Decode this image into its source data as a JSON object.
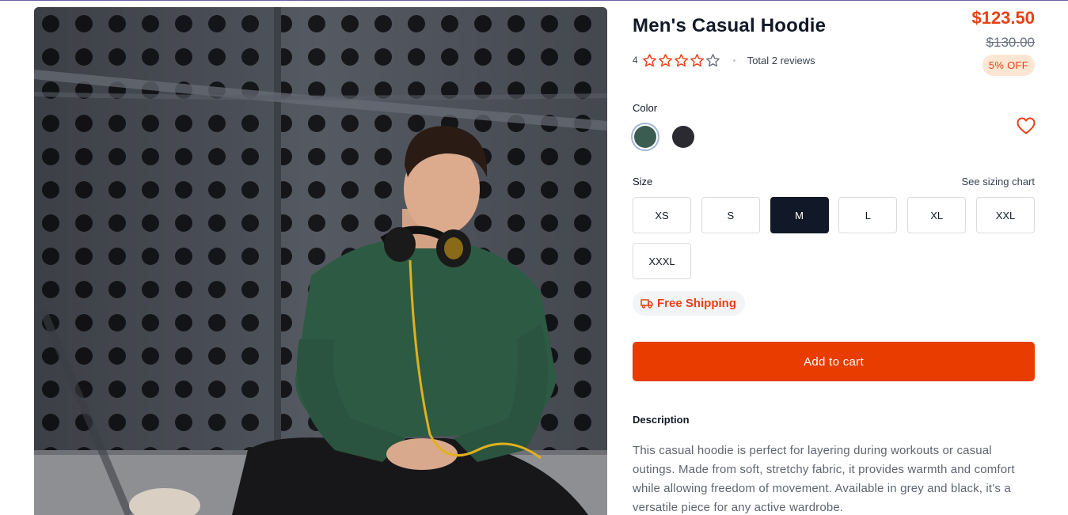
{
  "product": {
    "title": "Men's Casual Hoodie",
    "image_alt": "man in green hoodie with headphones",
    "price": "$123.50",
    "old_price": "$130.00",
    "discount": "5% OFF",
    "rating_value": "4",
    "rating_stars_filled": 4,
    "rating_stars_total": 5,
    "reviews": "Total 2 reviews"
  },
  "colors": {
    "label": "Color",
    "options": [
      {
        "name": "green",
        "hex": "#3b5c50",
        "selected": true
      },
      {
        "name": "black",
        "hex": "#2a2a30",
        "selected": false
      }
    ]
  },
  "sizes": {
    "label": "Size",
    "chart_link": "See sizing chart",
    "options": [
      "XS",
      "S",
      "M",
      "L",
      "XL",
      "XXL",
      "XXXL"
    ],
    "selected": "M"
  },
  "shipping": {
    "label": "Free Shipping",
    "icon": "truck-icon"
  },
  "cart": {
    "button_label": "Add to cart"
  },
  "description": {
    "title": "Description",
    "text": "This casual hoodie is perfect for layering during workouts or casual outings. Made from soft, stretchy fabric, it provides warmth and comfort while allowing freedom of movement. Available in grey and black, it’s a versatile piece for any active wardrobe."
  },
  "theme": {
    "accent": "#e83c00",
    "dark": "#111827"
  }
}
